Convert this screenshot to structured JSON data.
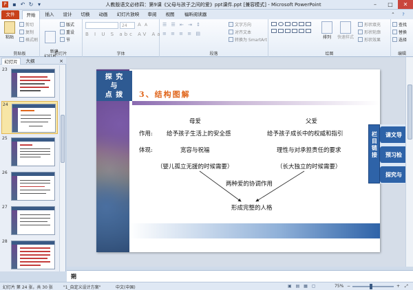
{
  "window": {
    "title": "人教版语文必修四：第9课《父母与孩子之间的爱》ppt课件.ppt [兼容模式] - Microsoft PowerPoint",
    "minimize": "–",
    "maximize": "□",
    "close": "✕"
  },
  "tabs": [
    "文件",
    "开始",
    "插入",
    "设计",
    "切换",
    "动画",
    "幻灯片放映",
    "审阅",
    "视图",
    "福昕阅读器"
  ],
  "ribbon": {
    "clipboard": {
      "label": "剪贴板",
      "paste": "粘贴",
      "cut": "剪切",
      "copy": "复制",
      "format_painter": "格式刷"
    },
    "slides": {
      "label": "幻灯片",
      "new_slide": "新建\n幻灯片",
      "layout": "版式",
      "reset": "重设",
      "section": "节"
    },
    "font": {
      "label": "字体",
      "size": "24"
    },
    "paragraph": {
      "label": "段落",
      "text_direction": "文字方向",
      "align_text": "对齐文本",
      "smartart": "转换为 SmartArt"
    },
    "drawing": {
      "label": "绘图",
      "arrange": "排列",
      "quick_styles": "快速样式",
      "shape_fill": "形状填充",
      "shape_outline": "形状轮廓",
      "shape_effects": "形状效果"
    },
    "editing": {
      "label": "编辑",
      "find": "查找",
      "replace": "替换",
      "select": "选择"
    }
  },
  "pane": {
    "tab_slides": "幻灯片",
    "tab_outline": "大纲",
    "close": "×",
    "thumbnails": [
      {
        "num": "23"
      },
      {
        "num": "24",
        "selected": true
      },
      {
        "num": "25"
      },
      {
        "num": "26"
      },
      {
        "num": "27"
      },
      {
        "num": "28"
      }
    ]
  },
  "slide": {
    "badge": [
      "探  究",
      "与",
      "点  拨"
    ],
    "headline": "3、结构图解",
    "col1_head": "母爱",
    "col2_head": "父爱",
    "row1_label": "作用:",
    "row1_col1": "给予孩子生活上的安全感",
    "row1_col2": "给予孩子成长中的权威和指引",
    "row2_label": "体现:",
    "row2_col1": "宽容与祝福",
    "row2_col2": "理性与对承担责任的要求",
    "paren1": "（婴儿孤立无援的时候需要）",
    "paren2": "（长大独立的时候需要）",
    "coordinate": "两种爱的协调作用",
    "result": "形成完整的人格",
    "side_panel": "栏目链接",
    "side_tabs": [
      "课文导",
      "预习检",
      "探究与"
    ]
  },
  "notes": {
    "text": "朔"
  },
  "status": {
    "slide_info": "幻灯片 第 24 张，共 30 张",
    "theme": "\"1_自定义设计方案\"",
    "language": "中文(中国)",
    "zoom": "75%",
    "zoom_fraction": 0.45
  },
  "colors": {
    "file_tab": "#c8411b",
    "headline": "#e0661c",
    "accent_blue": "#2e63a8"
  }
}
